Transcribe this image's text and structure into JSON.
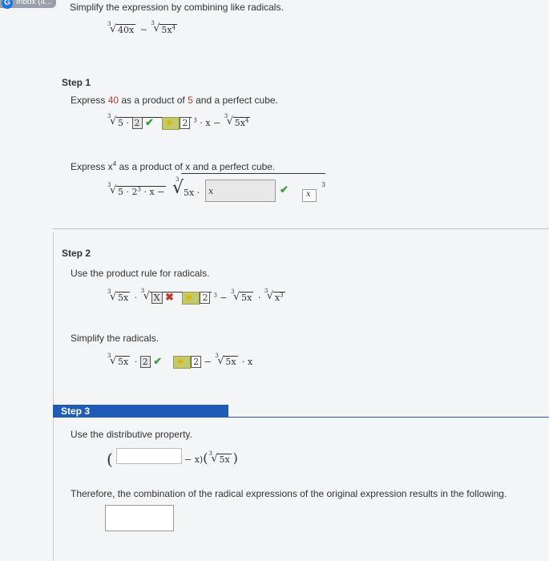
{
  "browser": {
    "tab_label": "Inbox (4..."
  },
  "problem": {
    "prompt": "Simplify the expression by combining like radicals.",
    "expr_term1": "40x",
    "expr_term2": "5x",
    "expr_term2_exp": "4",
    "minus": "−"
  },
  "step1": {
    "heading": "Step 1",
    "instr1_a": "Express ",
    "instr1_num": "40",
    "instr1_b": " as a product of ",
    "instr1_num2": "5",
    "instr1_c": " and a perfect cube.",
    "row1": {
      "a": "5 ·",
      "box_val": "2",
      "exp": "3",
      "rest": "· x −",
      "last": "5x",
      "last_exp": "4",
      "box2_val": "2"
    },
    "instr2_a": "Express x",
    "instr2_exp": "4",
    "instr2_b": " as a product of x and a perfect cube.",
    "row2": {
      "a": "5 · 2",
      "a_exp": "3",
      "a_rest": "· x −",
      "b": "5x ·",
      "box_val": "x",
      "small_box": "x",
      "exp": "3"
    }
  },
  "step2": {
    "heading": "Step 2",
    "instr1": "Use the product rule for radicals.",
    "row1": {
      "a": "5x",
      "b_box": "X",
      "key_val": "2",
      "exp": "3",
      "rest": "−",
      "c": "5x",
      "d": "x",
      "d_exp": "3"
    },
    "instr2": "Simplify the radicals.",
    "row2": {
      "a": "5x ·",
      "box_val": "2",
      "key_val": "2",
      "rest": "−",
      "c": "5x",
      "tail": "· x"
    }
  },
  "step3": {
    "heading": "Step 3",
    "instr1": "Use the distributive property.",
    "row": {
      "open": "(",
      "mid": "− x)",
      "rad": "5x"
    },
    "therefore": "Therefore, the combination of the radical expressions of the original expression results in the following."
  }
}
